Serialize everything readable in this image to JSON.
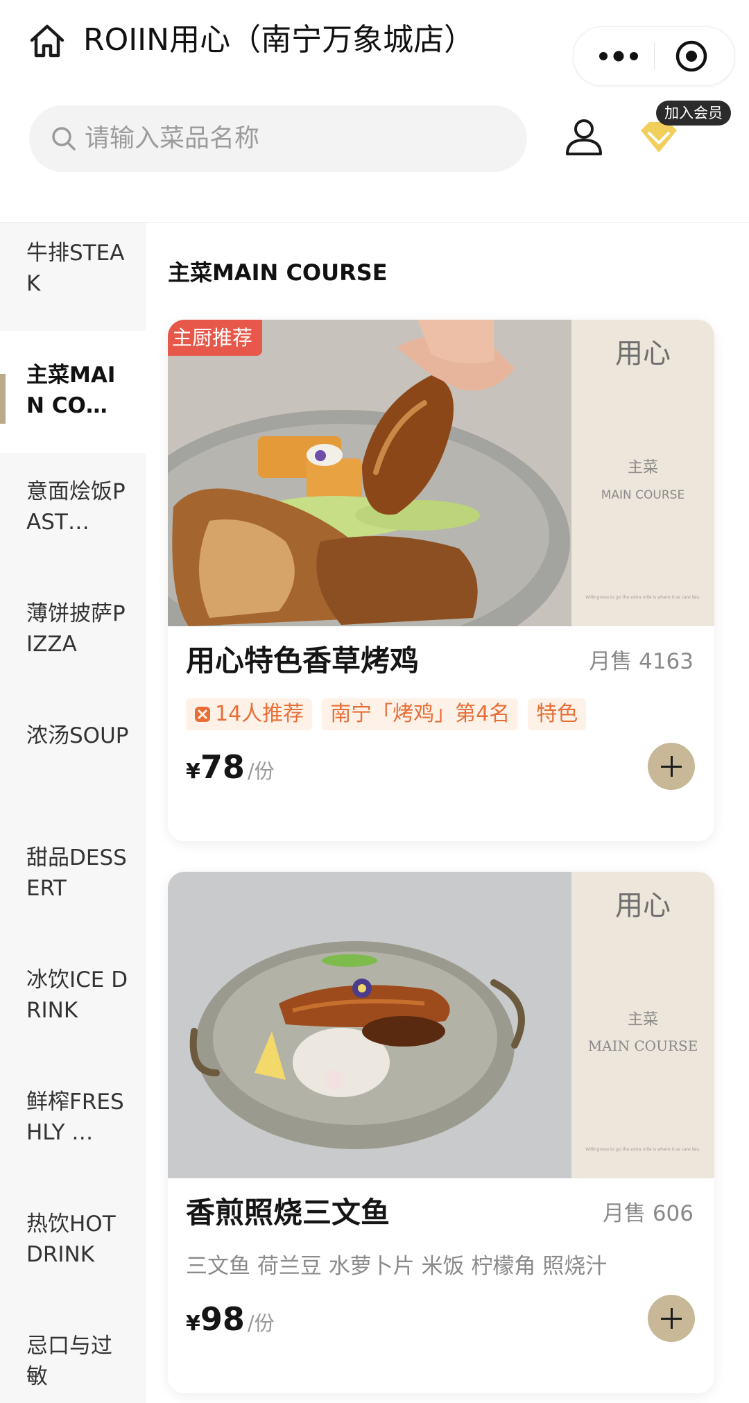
{
  "header": {
    "title": "ROIIN用心（南宁万象城店）",
    "search_placeholder": "请输入菜品名称",
    "member_badge": "加入会员"
  },
  "sidebar": {
    "items": [
      {
        "label": "牛排STEAK"
      },
      {
        "label": "主菜MAIN CO…"
      },
      {
        "label": "意面烩饭PAST…"
      },
      {
        "label": "薄饼披萨PIZZA"
      },
      {
        "label": "浓汤SOUP"
      },
      {
        "label": "甜品DESSERT"
      },
      {
        "label": "冰饮ICE DRINK"
      },
      {
        "label": "鲜榨FRESHLY …"
      },
      {
        "label": "热饮HOT DRINK"
      },
      {
        "label": "忌口与过敏"
      }
    ],
    "active_index": 1
  },
  "main": {
    "section_title": "主菜MAIN COURSE",
    "dishes": [
      {
        "ribbon": "主厨推荐",
        "name": "用心特色香草烤鸡",
        "sales": "月售 4163",
        "tags": [
          "14人推荐",
          "南宁「烤鸡」第4名",
          "特色"
        ],
        "currency": "¥",
        "price": "78",
        "unit": "/份",
        "panel_brand": "用心",
        "panel_cn": "主菜",
        "panel_en": "MAIN COURSE",
        "panel_note": "Willingness to go the extra mile is where true care lies."
      },
      {
        "name": "香煎照烧三文鱼",
        "sales": "月售 606",
        "desc": "三文鱼 荷兰豆 水萝卜片 米饭 柠檬角 照烧汁",
        "currency": "¥",
        "price": "98",
        "unit": "/份",
        "panel_brand": "用心",
        "panel_cn": "主菜",
        "panel_en": "MAIN COURSE",
        "panel_note": "Willingness to go the extra mile is where true care lies."
      }
    ]
  },
  "colors": {
    "accent": "#c8b898",
    "ribbon": "#e7574a",
    "tag_text": "#e86e35",
    "tag_bg": "#fdf1e8",
    "sidebar_bg": "#f7f7f7",
    "member_gold": "#f2cf5b"
  },
  "icons": {
    "home": "home-icon",
    "more": "more-dots-icon",
    "close": "target-circle-icon",
    "search": "search-icon",
    "user": "user-icon",
    "member": "diamond-icon",
    "add": "plus-icon"
  }
}
